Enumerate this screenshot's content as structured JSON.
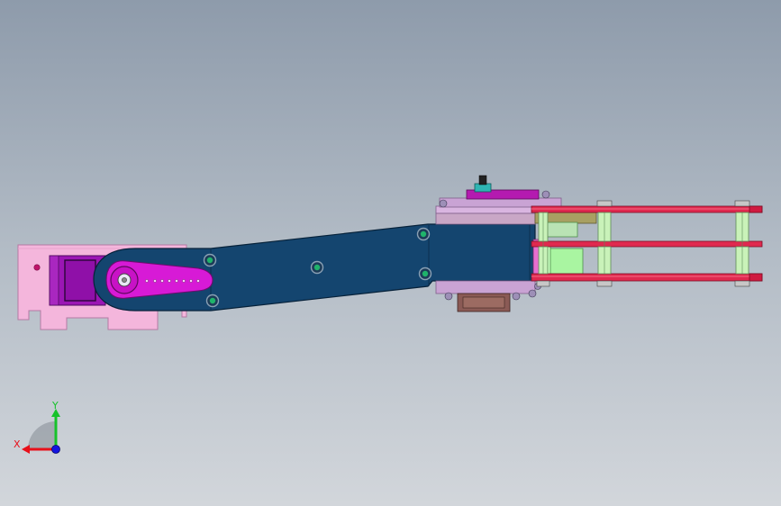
{
  "window": {
    "kind": "cad-3d-viewport",
    "view": "front"
  },
  "triad": {
    "x_label": "X",
    "y_label": "Y",
    "colors": {
      "x": "#e8101a",
      "y": "#16c22a",
      "z": "#1414e0"
    }
  },
  "model": {
    "colors": {
      "base_bracket": "#f4b6dc",
      "servo_body": "#9b16b4",
      "servo_horn": "#d71ad6",
      "arm_link": "#14456f",
      "gripper_housing": "#d9b5e0",
      "gripper_fingers": "#e0294f",
      "spacer": "#c9f2b9",
      "motor": "#a9f5a1",
      "bolt": "#1fb36b"
    }
  }
}
